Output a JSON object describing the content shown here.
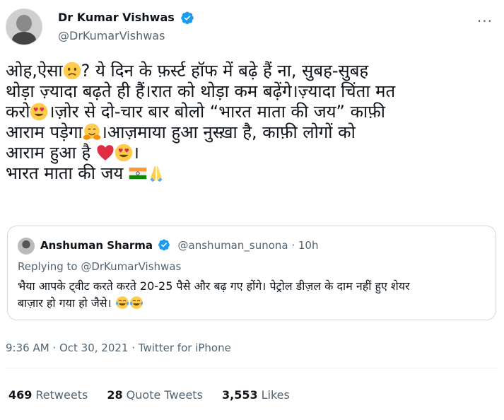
{
  "author": {
    "name": "Dr Kumar Vishwas",
    "handle": "@DrKumarVishwas"
  },
  "more_label": "···",
  "tweet": {
    "line1_a": "ओह,ऐसा",
    "line1_b": "? ये दिन के फ़र्स्ट हॉफ में बढ़े हैं ना, सुबह-सुबह",
    "line2": "थोड़ा ज़्यादा बढ़ते ही हैं।रात को थोड़ा कम बढ़ेंगे।ज़्यादा चिंता मत",
    "line3_a": "करो",
    "line3_b": "।ज़ोर से दो-चार बार बोलो “भारत माता की जय” काफ़ी",
    "line4_a": "आराम पड़ेगा",
    "line4_b": "।आज़माया हुआ नुस्ख़ा है, काफ़ी लोगों को",
    "line5_a": "आराम हुआ है ",
    "line5_b": "।",
    "line6": "भारत माता की जय "
  },
  "quote": {
    "name": "Anshuman Sharma",
    "handle": "@anshuman_sunona · 10h",
    "replying_prefix": "Replying to ",
    "replying_to": "@DrKumarVishwas",
    "text_line1": "भैया आपके ट्वीट करते करते 20-25 पैसे और बढ़ गए होंगे। पेट्रोल डीज़ल के दाम नहीं हुए शेयर",
    "text_line2": "बाज़ार हो गया हो जैसे। "
  },
  "meta": "9:36 AM · Oct 30, 2021 · Twitter for iPhone",
  "stats": [
    {
      "num": "469",
      "label": "Retweets"
    },
    {
      "num": "28",
      "label": "Quote Tweets"
    },
    {
      "num": "3,553",
      "label": "Likes"
    }
  ],
  "colors": {
    "verified": "#1d9bf0",
    "secondary_text": "#536471",
    "border": "#cfd9de"
  }
}
